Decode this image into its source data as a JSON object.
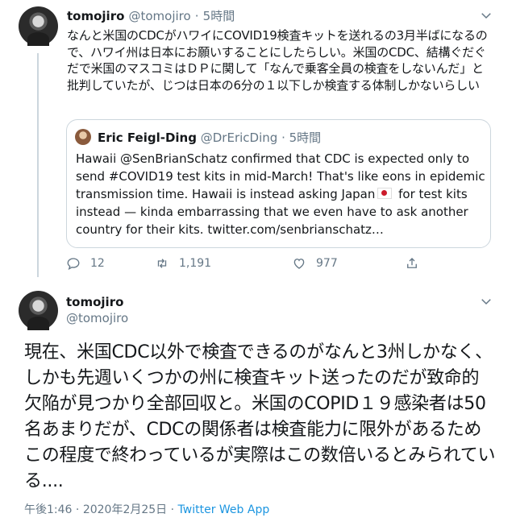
{
  "tweet1": {
    "name": "tomojiro",
    "handle": "@tomojiro",
    "separator": "·",
    "time": "5時間",
    "text": "なんと米国のCDCがハワイにCOVID19検査キットを送れるの3月半ばになるので、ハワイ州は日本にお願いすることにしたらしい。米国のCDC、結構ぐだぐだで米国のマスコミはＤＰに関して「なんで乗客全員の検査をしないんだ」と批判していたが、じつは日本の6分の１以下しか検査する体制しかないらしい",
    "quoted": {
      "name": "Eric Feigl-Ding",
      "handle": "@DrEricDing",
      "separator": "·",
      "time": "5時間",
      "text_before_flag": "Hawaii @SenBrianSchatz confirmed that CDC is expected only to send #COVID19 test kits in mid-March! That's like eons in epidemic transmission time. Hawaii is instead asking Japan",
      "text_after_flag": " for test kits instead — kinda embarrassing that we even have to ask another country for their kits. twitter.com/senbrianschatz…"
    },
    "actions": {
      "reply_count": "12",
      "retweet_count": "1,191",
      "like_count": "977"
    }
  },
  "tweet2": {
    "name": "tomojiro",
    "handle": "@tomojiro",
    "text": "現在、米国CDC以外で検査できるのがなんと3州しかなく、しかも先週いくつかの州に検査キット送ったのだが致命的欠陥が見つかり全部回収と。米国のCOPID１９感染者は50名あまりだが、CDCの関係者は検査能力に限外があるためこの程度で終わっているが実際はこの数倍いるとみられている....",
    "time": "午後1:46",
    "separator1": "·",
    "date": "2020年2月25日",
    "separator2": "·",
    "source": "Twitter Web App"
  },
  "colors": {
    "text": "#14171a",
    "secondary": "#657786",
    "link": "#1b95e0",
    "border": "#ccd6dd"
  }
}
